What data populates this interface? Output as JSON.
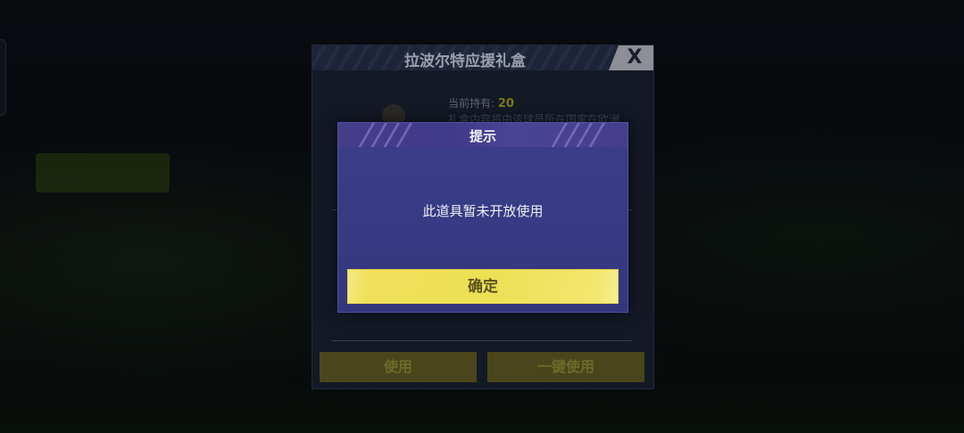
{
  "gift_panel": {
    "title": "拉波尔特应援礼盒",
    "close_label": "X",
    "holding_label": "当前持有:",
    "holding_value": "20",
    "description": "礼盒内容将由该球员所在国家在欧洲",
    "use_label": "使用",
    "use_all_label": "一键使用"
  },
  "dialog": {
    "title": "提示",
    "message": "此道具暂未开放使用",
    "confirm_label": "确定"
  },
  "colors": {
    "dialog_bg": "#383c86",
    "confirm_bg": "#ece053",
    "holding_value": "#7d7a1d"
  }
}
